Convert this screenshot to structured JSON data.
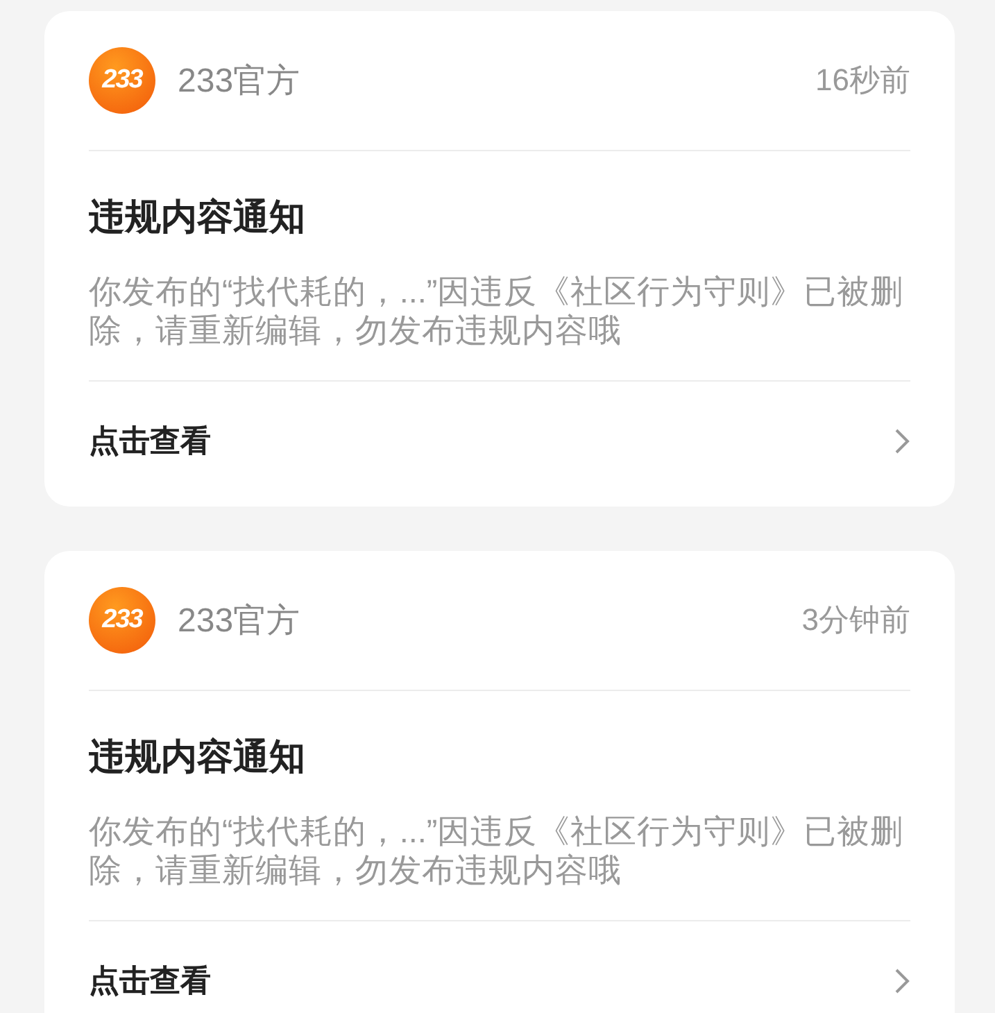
{
  "notifications": [
    {
      "logo_text": "233",
      "sender": "233官方",
      "time": "16秒前",
      "title": "违规内容通知",
      "body": "你发布的“找代耗的，...”因违反《社区行为守则》已被删除，请重新编辑，勿发布违规内容哦",
      "action": "点击查看"
    },
    {
      "logo_text": "233",
      "sender": "233官方",
      "time": "3分钟前",
      "title": "违规内容通知",
      "body": "你发布的“找代耗的，...”因违反《社区行为守则》已被删除，请重新编辑，勿发布违规内容哦",
      "action": "点击查看"
    }
  ]
}
